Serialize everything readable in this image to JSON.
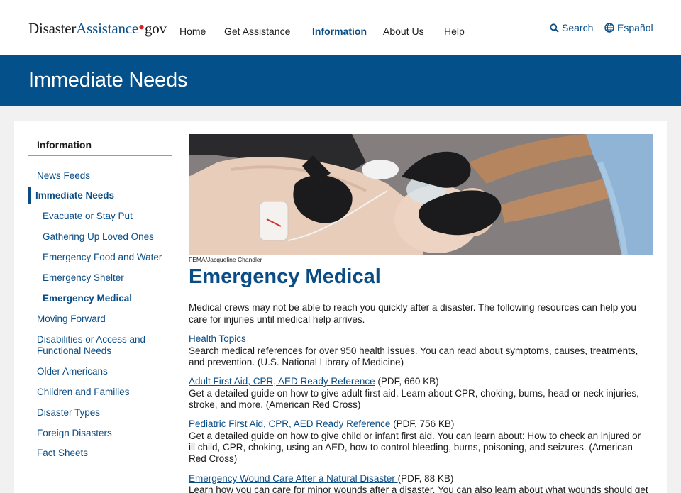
{
  "header": {
    "logo_left": "Disaster",
    "logo_mid": "Assistance",
    "logo_dot": "•",
    "logo_right": "gov",
    "nav": [
      "Home",
      "Get Assistance",
      "Information",
      "About Us",
      "Help"
    ],
    "search_label": "Search",
    "language_label": "Español"
  },
  "banner": {
    "title": "Immediate Needs"
  },
  "sidebar": {
    "heading": "Information",
    "items": [
      "News Feeds",
      "Immediate Needs",
      "Evacuate or Stay Put",
      "Gathering Up Loved Ones",
      "Emergency Food and Water",
      "Emergency Shelter",
      "Emergency Medical",
      "Moving Forward",
      "Disabilities or Access and",
      "Functional Needs",
      "Older Americans",
      "Children and Families",
      "Disaster Types",
      "Foreign Disasters",
      "Fact Sheets"
    ]
  },
  "main": {
    "photo_credit": "FEMA/Jacqueline Chandler",
    "title": "Emergency Medical",
    "intro_1": "Medical crews may not be able to reach you quickly after a disaster. The following resources can help you",
    "intro_2": "care for injuries until medical help arrives.",
    "resources": [
      {
        "link": "Health Topics",
        "meta": "",
        "lines": [
          "Search medical references for over 950 health issues. You can read about symptoms, causes, treatments,",
          "and prevention. (U.S. National Library of Medicine)"
        ]
      },
      {
        "link": "Adult First Aid, CPR, AED Ready Reference",
        "meta": " (PDF, 660 KB)",
        "lines": [
          "Get a detailed guide on how to give adult first aid. Learn about CPR, choking, burns, head or neck injuries,",
          "stroke, and more.  (American Red Cross)"
        ]
      },
      {
        "link": "Pediatric First Aid, CPR, AED Ready Reference",
        "meta": " (PDF, 756 KB)",
        "lines": [
          "Get a detailed guide on how to give child or infant first aid. You can learn about: How to check an injured or",
          "ill child, CPR, choking, using an AED, how to control bleeding, burns, poisoning, and seizures. (American",
          "Red Cross)"
        ]
      },
      {
        "link": "Emergency Wound Care After a Natural Disaster ",
        "meta": "(PDF, 88 KB)",
        "lines": [
          "Learn how you can care for minor wounds after a disaster. You can also learn about what wounds should get"
        ]
      }
    ]
  },
  "colors": {
    "brand_blue": "#04508a",
    "link_blue": "#0a4d86",
    "logo_red": "#d42325"
  }
}
